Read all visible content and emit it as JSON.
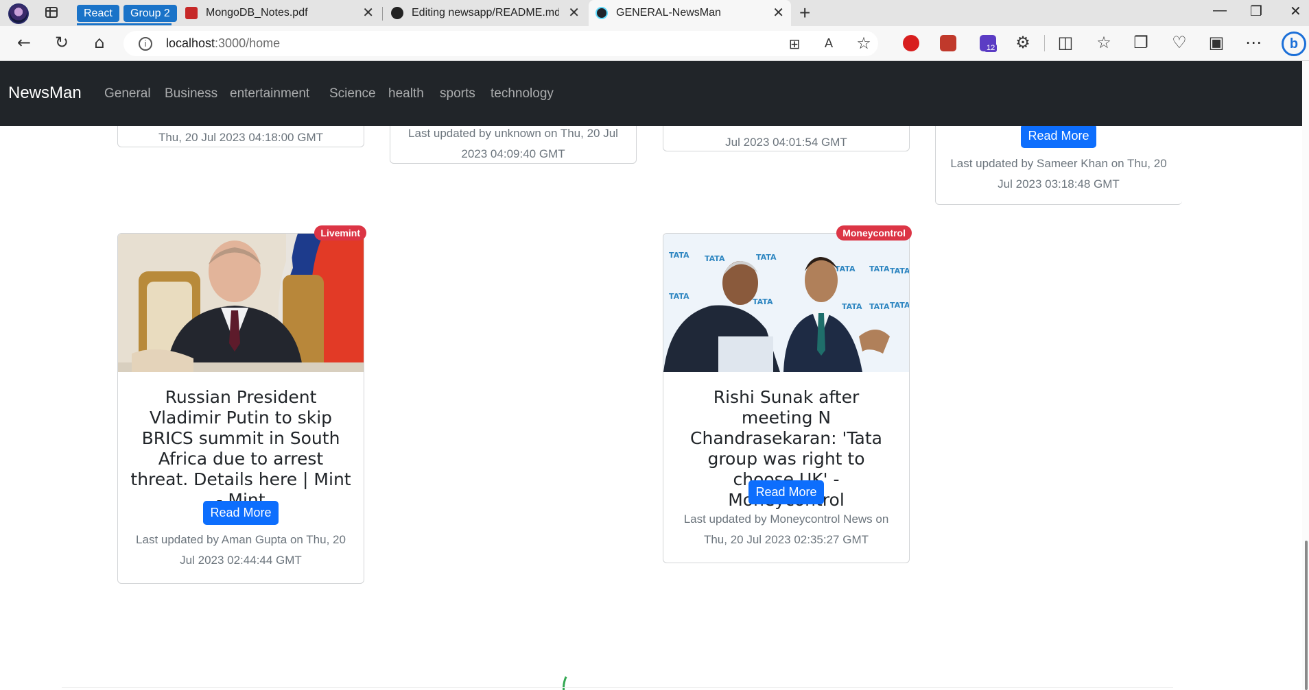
{
  "browser": {
    "tab_groups": [
      "React",
      "Group 2"
    ],
    "tabs": [
      {
        "title": "MongoDB_Notes.pdf",
        "icon": "pdf-icon"
      },
      {
        "title": "Editing newsapp/README.md at",
        "icon": "github-icon"
      },
      {
        "title": "GENERAL-NewsMan",
        "icon": "react-icon"
      }
    ],
    "new_tab": "+",
    "address": {
      "host": "localhost",
      "path": ":3000/home"
    },
    "extension_badge": "12",
    "window_controls": {
      "minimize": "—",
      "restore": "❐",
      "close": "✕"
    }
  },
  "navbar": {
    "brand": "NewsMan",
    "links": [
      "General",
      "Business",
      "entertainment",
      "Science",
      "health",
      "sports",
      "technology"
    ]
  },
  "top_cards": [
    {
      "footer": "Thu, 20 Jul 2023 04:18:00 GMT"
    },
    {
      "footer_line1": "Last updated by unknown on Thu, 20 Jul",
      "footer_line2": "2023 04:09:40 GMT"
    },
    {
      "footer": "Jul 2023 04:01:54 GMT"
    },
    {
      "button": "Read More",
      "footer_line1": "Last updated by Sameer Khan on Thu, 20",
      "footer_line2": "Jul 2023 03:18:48 GMT"
    }
  ],
  "articles": [
    {
      "source": "Livemint",
      "title": "Russian President Vladimir Putin to skip BRICS summit in South Africa due to arrest threat. Details here | Mint - Mint",
      "button": "Read More",
      "footer_line1": "Last updated by Aman Gupta on Thu, 20",
      "footer_line2": "Jul 2023 02:44:44 GMT"
    },
    {
      "source": "Moneycontrol",
      "title": "Rishi Sunak after meeting N Chandrasekaran: 'Tata group was right to choose UK' - Moneycontrol",
      "button": "Read More",
      "footer_line1": "Last updated by Moneycontrol News on",
      "footer_line2": "Thu, 20 Jul 2023 02:35:27 GMT"
    }
  ],
  "tata_logo_text": "TATA",
  "colors": {
    "navbar": "#212529",
    "primary": "#0d6efd",
    "badge": "#dc3545",
    "spinner": "#34a853"
  }
}
